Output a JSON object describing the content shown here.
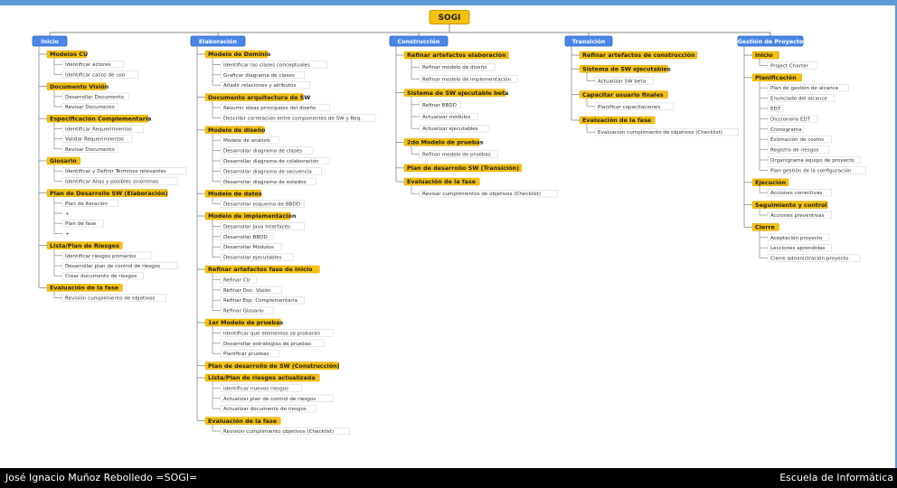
{
  "root": {
    "label": "SOGI"
  },
  "branches": [
    {
      "label": "Inicio",
      "children": [
        {
          "label": "Modelos CU",
          "children": [
            "Identificar actores",
            "Identificar casos de uso"
          ]
        },
        {
          "label": "Documento Visión",
          "children": [
            "Desarrollar Documento",
            "Revisar Documento"
          ]
        },
        {
          "label": "Especificación Complementaria",
          "children": [
            "Identificar Requerimientos",
            "Validar Requerimientos",
            "Revisar Documento"
          ]
        },
        {
          "label": "Glosario",
          "children": [
            "Identificar y Definir Términos relevantes",
            "Identificar Alias y posibles sinónimos"
          ]
        },
        {
          "label": "Plan de Desarrollo SW (Elaboración)",
          "children": [
            "Plan de iteración",
            "+",
            "Plan de fase",
            "+"
          ]
        },
        {
          "label": "Lista/Plan de Riesgos",
          "children": [
            "Identificar riesgos primarios",
            "Desarrollar plan de control de riesgos",
            "Crear documento de riesgos"
          ]
        },
        {
          "label": "Evaluación de la fase",
          "children": [
            "Revisión cumplimiento de objetivos"
          ]
        }
      ]
    },
    {
      "label": "Elaboración",
      "children": [
        {
          "label": "Modelo de Dominio",
          "children": [
            "Identificar las clases conceptuales",
            "Graficar diagrama de clases",
            "Añadir relaciones y atributos"
          ]
        },
        {
          "label": "Documento arquitectura de SW",
          "children": [
            "Resumir ideas principales del diseño",
            "Describir correlación entre componentes de SW y Req."
          ]
        },
        {
          "label": "Modelo de diseño",
          "children": [
            "Modelo de análisis",
            "Desarrollar diagrama de clases",
            "Desarrollar diagrama de colaboración",
            "Desarrollar diagrama de secuencia",
            "Desarrollar diagrama de estados"
          ]
        },
        {
          "label": "Modelo de datos",
          "children": [
            "Desarrollar esquema de BBDD"
          ]
        },
        {
          "label": "Modelo de implementación",
          "children": [
            "Desarrollar Java Interfaces",
            "Desarrollar BBDD",
            "Desarrollar Módulos",
            "Desarrollar ejecutables"
          ]
        },
        {
          "label": "Refinar artefactos fase de Inicio",
          "children": [
            "Refinar CU",
            "Refinar Doc. Visión",
            "Refinar Esp. Complementaria",
            "Refinar Glosario"
          ]
        },
        {
          "label": "1er Modelo de pruebas",
          "children": [
            "Identificar que elementos se probarán",
            "Desarrollar estrategias de pruebas",
            "Planificar pruebas"
          ]
        },
        {
          "label": "Plan de desarrollo de SW (Construcción)",
          "children": []
        },
        {
          "label": "Lista/Plan de riesgos actualizada",
          "children": [
            "Identificar nuevos riesgos",
            "Actualizar plan de control de riesgos",
            "Actualizar documento de riesgos"
          ]
        },
        {
          "label": "Evaluación de la fase",
          "children": [
            "Revisión cumplimiento objetivos (Checklist)"
          ]
        }
      ]
    },
    {
      "label": "Construcción",
      "children": [
        {
          "label": "Refinar artefactos elaboración",
          "children": [
            "Refinar modelo de diseño",
            "Refinar modelo de implementación"
          ]
        },
        {
          "label": "Sistema de SW ejecutable beta",
          "children": [
            "Refinar BBDD",
            "Actualizar módulos",
            "Actualizar ejecutables"
          ]
        },
        {
          "label": "2do Modelo de pruebas",
          "children": [
            "Refinar modelo de pruebas"
          ]
        },
        {
          "label": "Plan de desarrollo SW (Transición)",
          "children": []
        },
        {
          "label": "Evaluación de la fase",
          "children": [
            "Revisar cumplimientos de objetivos (Checklist)"
          ]
        }
      ]
    },
    {
      "label": "Transición",
      "children": [
        {
          "label": "Refinar artefactos de construcción",
          "children": []
        },
        {
          "label": "Sistema de SW ejecutables",
          "children": [
            "Actualizar SW beta"
          ]
        },
        {
          "label": "Capacitar usuario finales",
          "children": [
            "Planificar capacitaciones"
          ]
        },
        {
          "label": "Evaluación de la fase",
          "children": [
            "Evaluación cumplimiento de objetivos (Checklist)"
          ]
        }
      ]
    },
    {
      "label": "Gestión de Proyecto",
      "children": [
        {
          "label": "Inicio",
          "children": [
            "Project Charter"
          ]
        },
        {
          "label": "Planificación",
          "children": [
            "Plan de gestión de alcance",
            "Enunciado del alcance",
            "EDT",
            "Diccionario EDT",
            "Cronograma",
            "Estimación de costos",
            "Registro de riesgos",
            "Organigrama equipo de proyecto",
            "Plan gestión de la configuración"
          ]
        },
        {
          "label": "Ejecución",
          "children": [
            "Acciones correctivas"
          ]
        },
        {
          "label": "Seguimiento y control",
          "children": [
            "Acciones preventivas"
          ]
        },
        {
          "label": "Cierre",
          "children": [
            "Aceptación proyecto",
            "Lecciones aprendidas",
            "Cierre administración proyecto"
          ]
        }
      ]
    }
  ],
  "footer": {
    "left": "José Ignacio Muñoz Rebolledo  =SOGI=",
    "right": "Escuela de Informática"
  },
  "colors": {
    "phase_blue": "#4a86e8",
    "yellow_node": "#f4c20d",
    "line": "#8a8a8a",
    "top_bar": "#5b9bd5",
    "footer_bg": "#000000"
  }
}
